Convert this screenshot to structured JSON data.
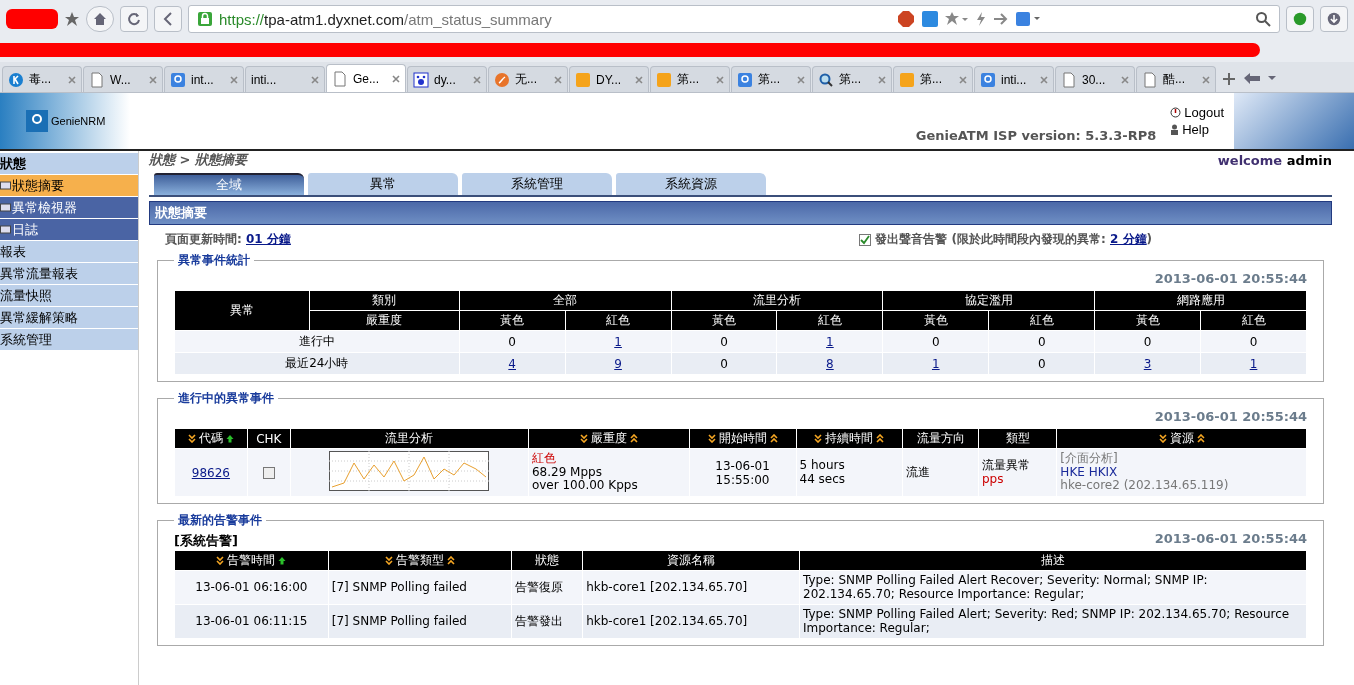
{
  "browser": {
    "url_scheme": "https://",
    "url_host": "tpa-atm1.dyxnet.com",
    "url_path": "/atm_status_summary",
    "tabs": [
      {
        "title": "毒...",
        "kind": "k",
        "selected": false
      },
      {
        "title": "W...",
        "kind": "page",
        "selected": false
      },
      {
        "title": "int...",
        "kind": "g",
        "selected": false
      },
      {
        "title": "inti...",
        "kind": "none",
        "selected": false
      },
      {
        "title": "Ge...",
        "kind": "page",
        "selected": true
      },
      {
        "title": "dy...",
        "kind": "paw",
        "selected": false
      },
      {
        "title": "无...",
        "kind": "flame",
        "selected": false
      },
      {
        "title": "DY...",
        "kind": "dyx",
        "selected": false
      },
      {
        "title": "第...",
        "kind": "dyx",
        "selected": false
      },
      {
        "title": "第...",
        "kind": "g",
        "selected": false
      },
      {
        "title": "第...",
        "kind": "magnifier",
        "selected": false
      },
      {
        "title": "第...",
        "kind": "dyx",
        "selected": false
      },
      {
        "title": "inti...",
        "kind": "g",
        "selected": false
      },
      {
        "title": "30...",
        "kind": "page",
        "selected": false
      },
      {
        "title": "酷...",
        "kind": "page",
        "selected": false
      }
    ]
  },
  "header": {
    "logo": "GenieNRM",
    "links": [
      "Logout",
      "Help"
    ],
    "version": "GenieATM ISP version: 5.3.3-RP8"
  },
  "sidebar": {
    "items": [
      {
        "label": "狀態",
        "kind": "heading",
        "selected": false
      },
      {
        "label": "狀態摘要",
        "kind": "sub",
        "selected": true
      },
      {
        "label": "異常檢視器",
        "kind": "sub",
        "selected": false
      },
      {
        "label": "日誌",
        "kind": "sub",
        "selected": false
      },
      {
        "label": "報表",
        "kind": "item",
        "selected": false
      },
      {
        "label": "異常流量報表",
        "kind": "item",
        "selected": false
      },
      {
        "label": "流量快照",
        "kind": "item",
        "selected": false
      },
      {
        "label": "異常緩解策略",
        "kind": "item",
        "selected": false
      },
      {
        "label": "系統管理",
        "kind": "item",
        "selected": false
      }
    ]
  },
  "breadcrumb": "狀態 > 狀態摘要",
  "welcome": {
    "greeting": "welcome",
    "user": "admin"
  },
  "tabs": [
    {
      "label": "全域",
      "selected": true
    },
    {
      "label": "異常",
      "selected": false
    },
    {
      "label": "系統管理",
      "selected": false
    },
    {
      "label": "系統資源",
      "selected": false
    }
  ],
  "section_title": "狀態摘要",
  "refresh": {
    "label": "頁面更新時間:",
    "value": "01 分鐘"
  },
  "sound_alert": {
    "checked": true,
    "label": "發出聲音告警 (限於此時間段內發現的異常:",
    "value": "2 分鐘",
    "suffix": ")"
  },
  "stats": {
    "title": "異常事件統計",
    "timestamp": "2013-06-01 20:55:44",
    "corner": "異常",
    "category_label": "類別",
    "severity_label": "嚴重度",
    "groups": [
      {
        "name": "全部",
        "levels": [
          "黃色",
          "紅色"
        ]
      },
      {
        "name": "流里分析",
        "levels": [
          "黃色",
          "紅色"
        ]
      },
      {
        "name": "協定濫用",
        "levels": [
          "黃色",
          "紅色"
        ]
      },
      {
        "name": "網路應用",
        "levels": [
          "黃色",
          "紅色"
        ]
      }
    ],
    "rows": [
      {
        "label": "進行中",
        "cells": [
          {
            "value": "0",
            "link": false
          },
          {
            "value": "1",
            "link": true
          },
          {
            "value": "0",
            "link": false
          },
          {
            "value": "1",
            "link": true
          },
          {
            "value": "0",
            "link": false
          },
          {
            "value": "0",
            "link": false
          },
          {
            "value": "0",
            "link": false
          },
          {
            "value": "0",
            "link": false
          }
        ]
      },
      {
        "label": "最近24小時",
        "cells": [
          {
            "value": "4",
            "link": true
          },
          {
            "value": "9",
            "link": true
          },
          {
            "value": "0",
            "link": false
          },
          {
            "value": "8",
            "link": true
          },
          {
            "value": "1",
            "link": true
          },
          {
            "value": "0",
            "link": false
          },
          {
            "value": "3",
            "link": true
          },
          {
            "value": "1",
            "link": true
          }
        ]
      }
    ]
  },
  "ongoing": {
    "title": "進行中的異常事件",
    "timestamp": "2013-06-01 20:55:44",
    "columns": [
      {
        "label": "代碼",
        "sortable": true,
        "sorted": true
      },
      {
        "label": "CHK",
        "sortable": false,
        "sorted": false
      },
      {
        "label": "流里分析",
        "sortable": false,
        "sorted": false
      },
      {
        "label": "嚴重度",
        "sortable": true,
        "sorted": false
      },
      {
        "label": "開始時間",
        "sortable": true,
        "sorted": false
      },
      {
        "label": "持續時間",
        "sortable": true,
        "sorted": false
      },
      {
        "label": "流量方向",
        "sortable": false,
        "sorted": false
      },
      {
        "label": "類型",
        "sortable": false,
        "sorted": false
      },
      {
        "label": "資源",
        "sortable": true,
        "sorted": false
      }
    ],
    "rows": [
      {
        "id": "98626",
        "checked": false,
        "severity": "紅色",
        "rate": "68.29 Mpps",
        "threshold": "over 100.00 Kpps",
        "start_date": "13-06-01",
        "start_time": "15:55:00",
        "duration_1": "5 hours",
        "duration_2": "44 secs",
        "direction": "流進",
        "type": "流量異常",
        "unit": "pps",
        "resource_note": "[介面分析]",
        "resource_link": "HKE HKIX",
        "resource_host": "hke-core2 (202.134.65.119)"
      }
    ]
  },
  "alerts": {
    "title": "最新的告警事件",
    "subtitle": "[系統告警]",
    "timestamp": "2013-06-01 20:55:44",
    "columns": [
      {
        "label": "告警時間",
        "sortable": true,
        "sorted": true
      },
      {
        "label": "告警類型",
        "sortable": true,
        "sorted": false
      },
      {
        "label": "狀態",
        "sortable": false,
        "sorted": false
      },
      {
        "label": "資源名稱",
        "sortable": false,
        "sorted": false
      },
      {
        "label": "描述",
        "sortable": false,
        "sorted": false
      }
    ],
    "rows": [
      {
        "time": "13-06-01 06:16:00",
        "type": "[7] SNMP Polling failed",
        "status": "告警復原",
        "resource": "hkb-core1 [202.134.65.70]",
        "description": "Type: SNMP Polling Failed Alert Recover; Severity: Normal; SNMP IP: 202.134.65.70; Resource Importance: Regular;"
      },
      {
        "time": "13-06-01 06:11:15",
        "type": "[7] SNMP Polling failed",
        "status": "告警發出",
        "resource": "hkb-core1 [202.134.65.70]",
        "description": "Type: SNMP Polling Failed Alert; Severity: Red; SNMP IP: 202.134.65.70; Resource Importance: Regular;"
      }
    ]
  }
}
